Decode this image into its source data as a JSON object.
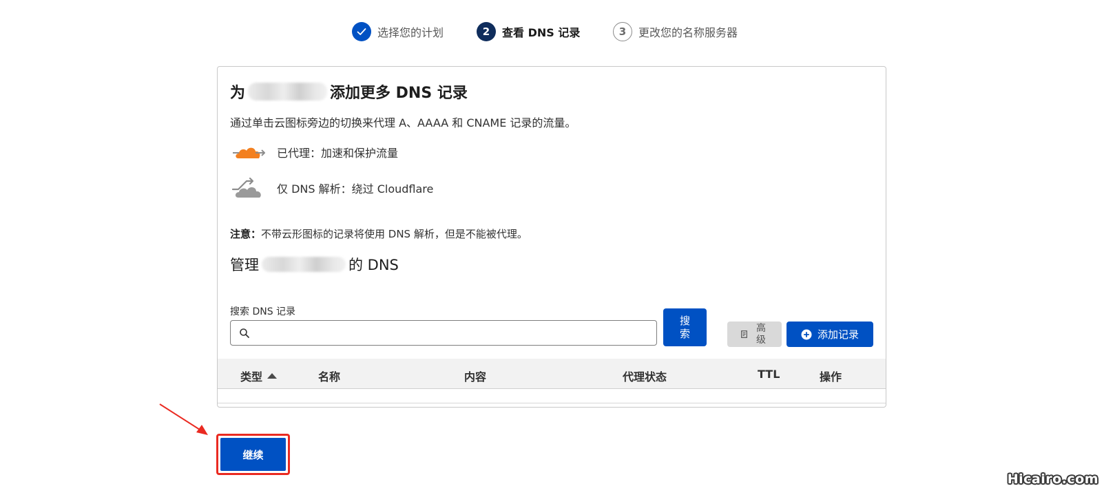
{
  "stepper": {
    "steps": [
      {
        "number": "",
        "label": "选择您的计划",
        "status": "completed",
        "icon": "check-icon"
      },
      {
        "number": "2",
        "label": "查看 DNS 记录",
        "status": "current"
      },
      {
        "number": "3",
        "label": "更改您的名称服务器",
        "status": "pending"
      }
    ]
  },
  "card": {
    "title_prefix": "为",
    "title_suffix": "添加更多 DNS 记录",
    "description": "通过单击云图标旁边的切换来代理 A、AAAA 和 CNAME 记录的流量。",
    "legend": {
      "proxied": "已代理：加速和保护流量",
      "dns_only": "仅 DNS 解析：绕过 Cloudflare"
    },
    "note_label": "注意：",
    "note_text": "不带云形图标的记录将使用 DNS 解析，但是不能被代理。",
    "manage_prefix": "管理",
    "manage_suffix": "的 DNS"
  },
  "search": {
    "label": "搜索 DNS 记录",
    "value": "",
    "placeholder": "",
    "button_label": "搜索"
  },
  "toolbar": {
    "advanced_label": "高级",
    "add_record_label": "添加记录"
  },
  "table": {
    "columns": [
      "类型",
      "名称",
      "内容",
      "代理状态",
      "TTL",
      "操作"
    ],
    "sort_column": "类型",
    "rows": []
  },
  "continue_label": "继续",
  "watermark": "Hicairo.com",
  "colors": {
    "primary": "#0051c3",
    "current_step": "#0f2d5c",
    "proxied_cloud": "#f38020",
    "dns_only_cloud": "#8f8f8f",
    "annotation": "#ea2a21"
  }
}
